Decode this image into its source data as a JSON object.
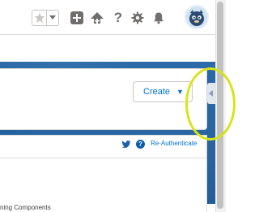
{
  "header": {
    "favorite_icon": "star-icon",
    "favorites_menu_icon": "caret-down-icon",
    "global_actions_icon": "plus-icon",
    "trailhead_icon": "trailhead-icon",
    "help_icon": "question-icon",
    "setup_icon": "gear-icon",
    "notifications_icon": "bell-icon",
    "avatar_icon": "astro-avatar-icon",
    "help_glyph": "?"
  },
  "toolbar": {
    "create_label": "Create",
    "create_caret": "▼",
    "side_panel_icon": "chevron-left-icon"
  },
  "card": {
    "twitter_icon": "twitter-icon",
    "help_glyph": "?",
    "reauthenticate_label": "Re-Authenticate"
  },
  "footer": {
    "partial_text": "ning Components"
  },
  "colors": {
    "accent": "#0070d2",
    "banner": "#1f5c99",
    "highlight_ring": "#d9e31a"
  }
}
